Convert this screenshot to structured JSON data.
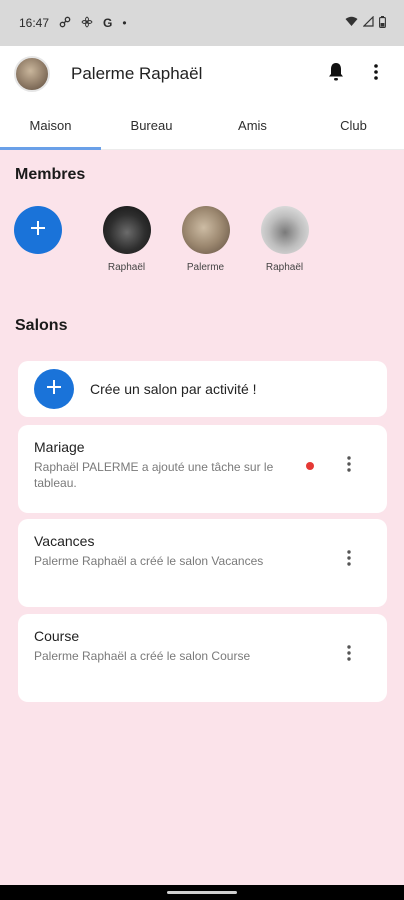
{
  "status": {
    "time": "16:47",
    "left_icons": [
      "link-icon",
      "fan-icon",
      "google-icon",
      "dot-icon"
    ],
    "right_icons": [
      "wifi-icon",
      "signal-icon",
      "battery-icon"
    ]
  },
  "appbar": {
    "title": "Palerme Raphaël",
    "actions": [
      "notifications-icon",
      "more-vert-icon"
    ]
  },
  "tabs": [
    {
      "label": "Maison",
      "active": true
    },
    {
      "label": "Bureau",
      "active": false
    },
    {
      "label": "Amis",
      "active": false
    },
    {
      "label": "Club",
      "active": false
    }
  ],
  "members": {
    "title": "Membres",
    "list": [
      {
        "name": "Raphaël"
      },
      {
        "name": "Palerme"
      },
      {
        "name": "Raphaël"
      }
    ]
  },
  "salons": {
    "title": "Salons",
    "create_label": "Crée un salon par activité !",
    "items": [
      {
        "name": "Mariage",
        "desc": "Raphaël PALERME a ajouté une tâche sur le tableau.",
        "unread": true
      },
      {
        "name": "Vacances",
        "desc": "Palerme Raphaël a créé le salon Vacances",
        "unread": false
      },
      {
        "name": "Course",
        "desc": "Palerme Raphaël a créé le salon Course",
        "unread": false
      }
    ]
  },
  "colors": {
    "accent": "#1a73d9",
    "background": "#fbe3ea",
    "tab_indicator": "#6aa0e8",
    "unread_dot": "#e53935"
  }
}
